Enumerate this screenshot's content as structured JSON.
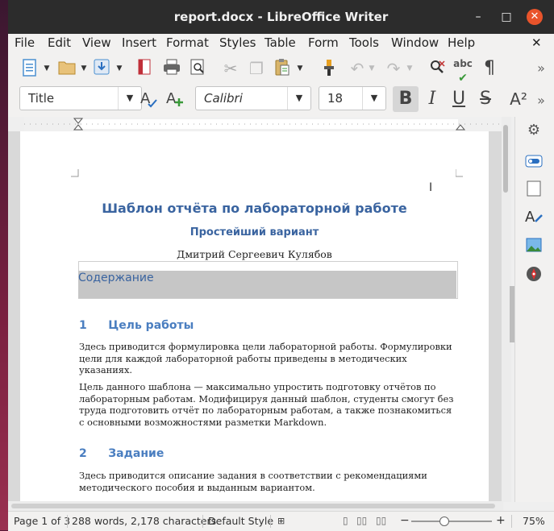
{
  "window": {
    "title": "report.docx - LibreOffice Writer"
  },
  "titlebar": {
    "minimize_glyph": "–",
    "maximize_glyph": "□",
    "close_glyph": "✕"
  },
  "menu": {
    "file": "File",
    "edit": "Edit",
    "view": "View",
    "insert": "Insert",
    "format": "Format",
    "styles": "Styles",
    "table": "Table",
    "form": "Form",
    "tools": "Tools",
    "window": "Window",
    "help": "Help",
    "close_doc": "✕"
  },
  "standard_toolbar": {
    "icons": [
      "new-document-icon",
      "open-folder-icon",
      "save-icon",
      "export-pdf-icon",
      "print-icon",
      "print-preview-icon",
      "cut-icon",
      "copy-icon",
      "paste-icon",
      "clone-formatting-icon",
      "undo-icon",
      "redo-icon",
      "spellcheck-icon",
      "autocorrect-icon",
      "formatting-marks-icon",
      "overflow-icon"
    ]
  },
  "format_toolbar": {
    "paragraph_style": "Title",
    "font_name": "Calibri",
    "font_size": "18",
    "bold": "B",
    "italic": "I",
    "underline": "U",
    "strikethrough": "S",
    "superscript": "A²"
  },
  "document": {
    "title": "Шаблон отчёта по лабораторной работе",
    "subtitle": "Простейший вариант",
    "author": "Дмитрий Сергеевич Кулябов",
    "toc_heading": "Содержание",
    "sections": [
      {
        "number": "1",
        "title": "Цель работы",
        "paragraphs": [
          "Здесь приводится формулировка цели лабораторной работы. Формулировки цели для каждой лабораторной работы приведены в методических указаниях.",
          "Цель данного шаблона — максимально упростить подготовку отчётов по лабораторным работам. Модифицируя данный шаблон, студенты смогут без труда подготовить отчёт по лабораторным работам, а также познакомиться с основными возможностями разметки Markdown."
        ]
      },
      {
        "number": "2",
        "title": "Задание",
        "paragraphs": [
          "Здесь приводится описание задания в соответствии с рекомендациями методического пособия и выданным вариантом."
        ]
      }
    ]
  },
  "statusbar": {
    "page": "Page 1 of 3",
    "words": "288 words, 2,178 characters",
    "page_style": "Default Style",
    "zoom": "75%"
  }
}
